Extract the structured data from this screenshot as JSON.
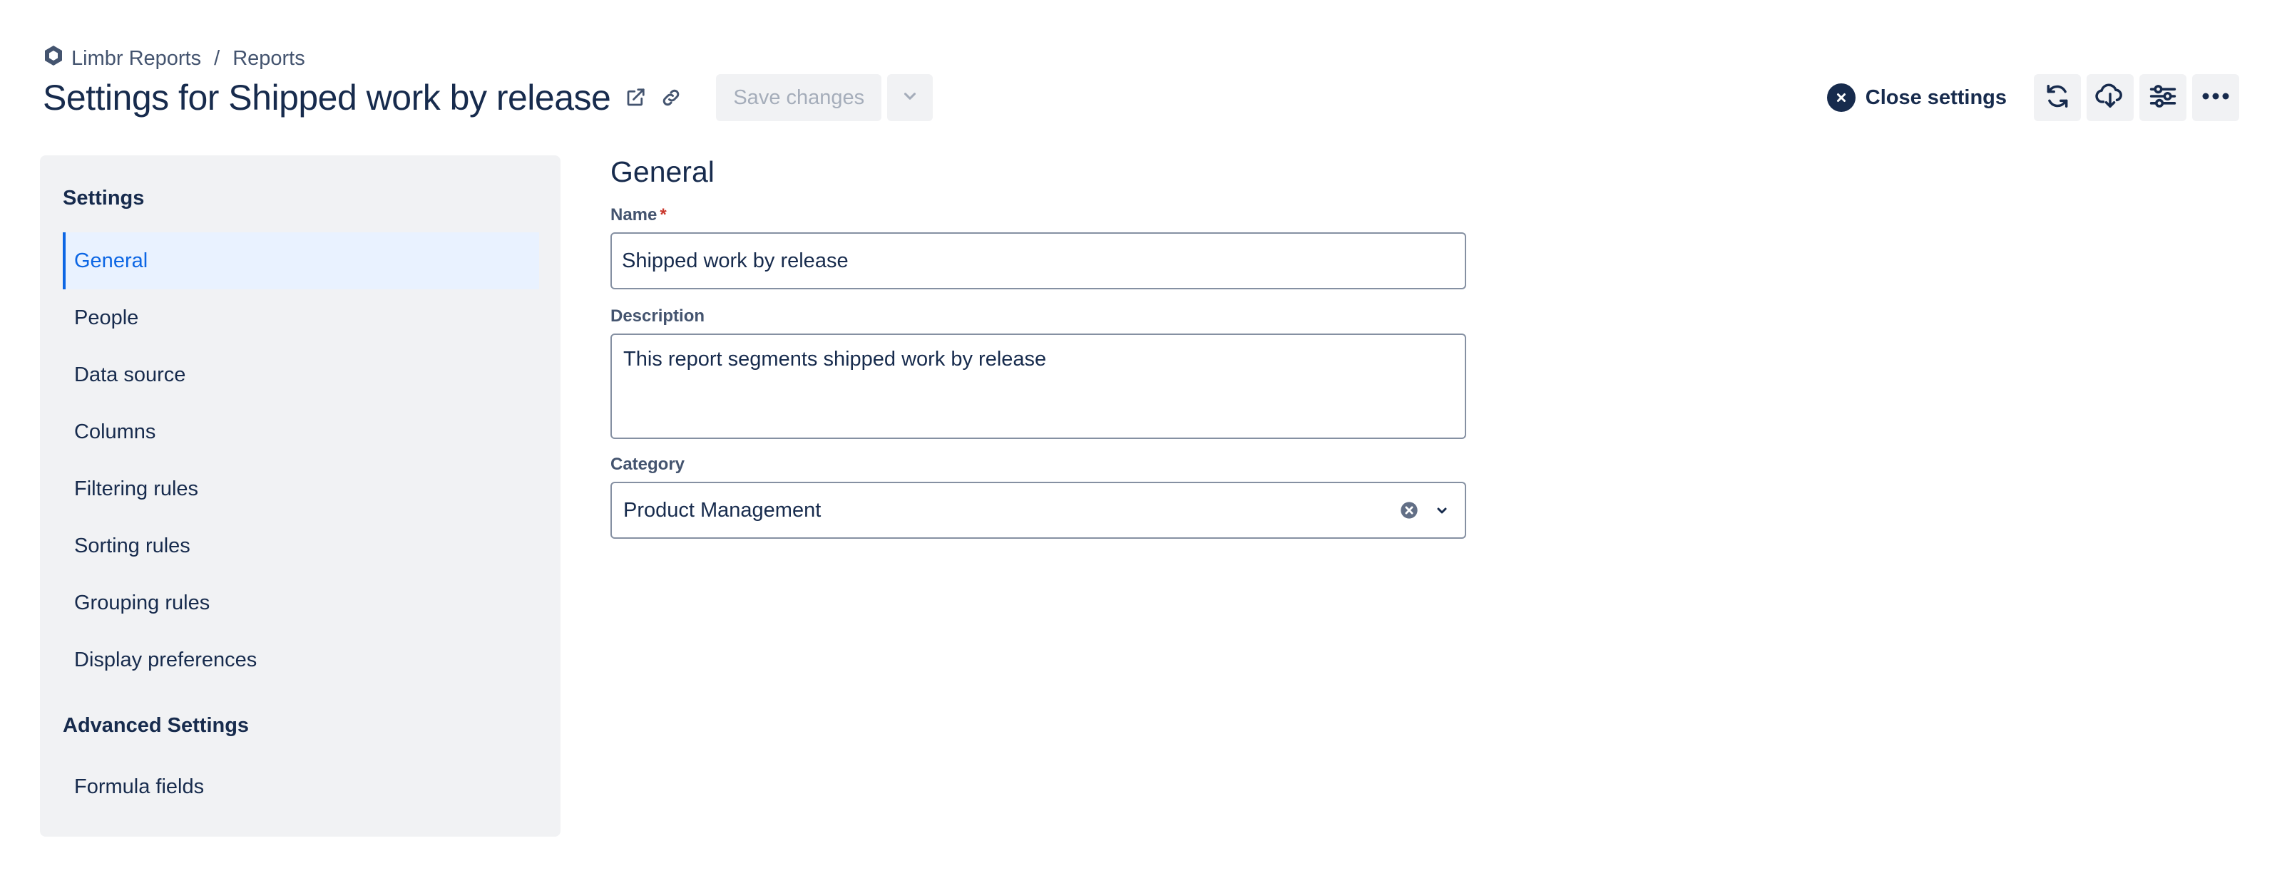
{
  "breadcrumb": {
    "app_icon": "hexagon-logo-icon",
    "app_name": "Limbr Reports",
    "separator": "/",
    "current": "Reports"
  },
  "header": {
    "title": "Settings for Shipped work by release",
    "open_external_icon": "external-link-icon",
    "copy_link_icon": "link-icon",
    "save_label": "Save changes",
    "save_dropdown_icon": "chevron-down-icon",
    "close_settings_label": "Close settings",
    "actions": [
      {
        "icon": "refresh-icon"
      },
      {
        "icon": "cloud-download-icon"
      },
      {
        "icon": "sliders-icon"
      },
      {
        "icon": "more-horizontal-icon"
      }
    ]
  },
  "sidebar": {
    "heading": "Settings",
    "items": [
      {
        "label": "General",
        "active": true
      },
      {
        "label": "People"
      },
      {
        "label": "Data source"
      },
      {
        "label": "Columns"
      },
      {
        "label": "Filtering rules"
      },
      {
        "label": "Sorting rules"
      },
      {
        "label": "Grouping rules"
      },
      {
        "label": "Display preferences"
      }
    ],
    "advanced_heading": "Advanced Settings",
    "advanced_items": [
      {
        "label": "Formula fields"
      }
    ]
  },
  "main": {
    "section_title": "General",
    "name_label": "Name",
    "name_required_mark": "*",
    "name_value": "Shipped work by release",
    "description_label": "Description",
    "description_value": "This report segments shipped work by release",
    "category_label": "Category",
    "category_value": "Product Management"
  },
  "colors": {
    "accent": "#0c66e4",
    "active_bg": "#e9f2ff",
    "text": "#172b4d",
    "sidebar_bg": "#f1f2f4",
    "required": "#c9372c"
  }
}
